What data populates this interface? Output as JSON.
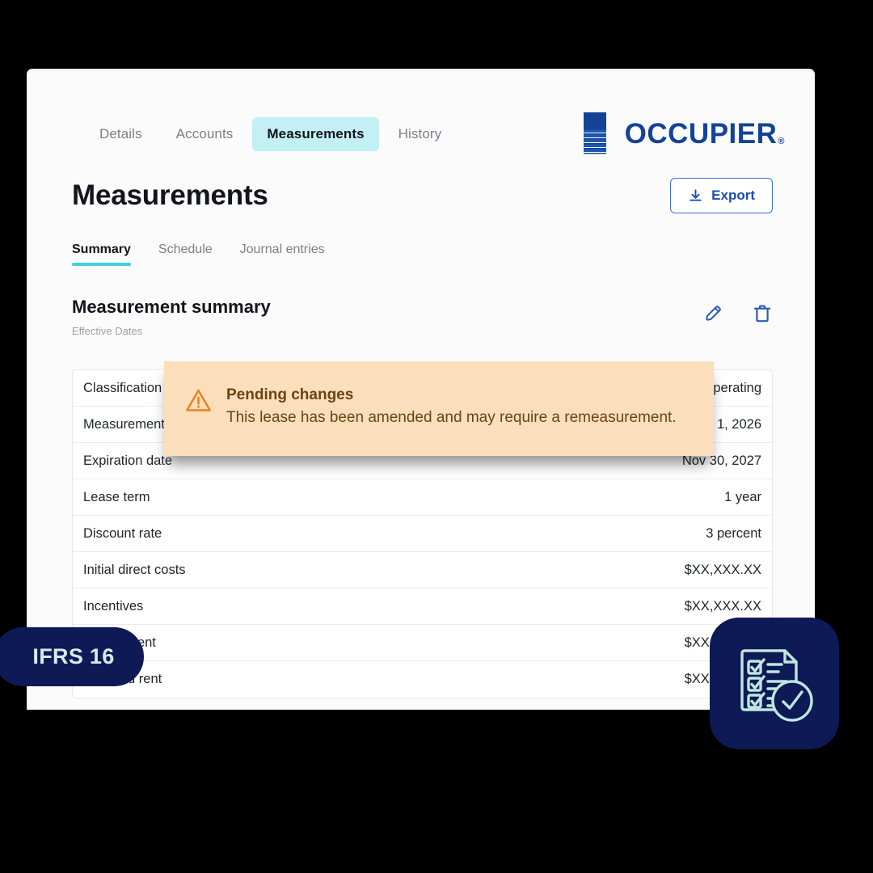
{
  "brand": {
    "name": "OCCUPIER",
    "registered_mark": "®",
    "logo_color": "#134395",
    "accent_cyan": "#3fd0e4",
    "navy": "#0d1a56",
    "mint": "#cfeee9"
  },
  "top_nav": {
    "tabs": [
      {
        "label": "Details",
        "active": false
      },
      {
        "label": "Accounts",
        "active": false
      },
      {
        "label": "Measurements",
        "active": true
      },
      {
        "label": "History",
        "active": false
      }
    ]
  },
  "header": {
    "title": "Measurements",
    "export_label": "Export",
    "export_icon": "download-icon"
  },
  "sub_tabs": [
    {
      "label": "Summary",
      "active": true
    },
    {
      "label": "Schedule",
      "active": false
    },
    {
      "label": "Journal entries",
      "active": false
    }
  ],
  "section": {
    "title": "Measurement summary",
    "subtitle": "Effective Dates",
    "edit_icon": "pencil-icon",
    "delete_icon": "trash-icon"
  },
  "table": {
    "rows": [
      {
        "label": "Classification",
        "value": "Operating"
      },
      {
        "label": "Measurement date",
        "value": "Dec 1, 2026"
      },
      {
        "label": "Expiration date",
        "value": "Nov 30, 2027"
      },
      {
        "label": "Lease term",
        "value": "1 year"
      },
      {
        "label": "Discount rate",
        "value": "3 percent"
      },
      {
        "label": "Initial direct costs",
        "value": "$XX,XXX.XX"
      },
      {
        "label": "Incentives",
        "value": "$XX,XXX.XX"
      },
      {
        "label": "Prepaid rent",
        "value": "$XX,XXX.XX"
      },
      {
        "label": "Deferred rent",
        "value": "$XX,XXX.XX"
      }
    ]
  },
  "alert": {
    "icon": "warning-triangle-icon",
    "title": "Pending changes",
    "message": "This lease has been amended and may require a remeasurement.",
    "background": "#fbdfbc",
    "text_color": "#6c4313",
    "icon_color": "#ef7f1f"
  },
  "badges": {
    "standard_label": "IFRS 16",
    "checklist_icon": "checklist-check-icon"
  }
}
